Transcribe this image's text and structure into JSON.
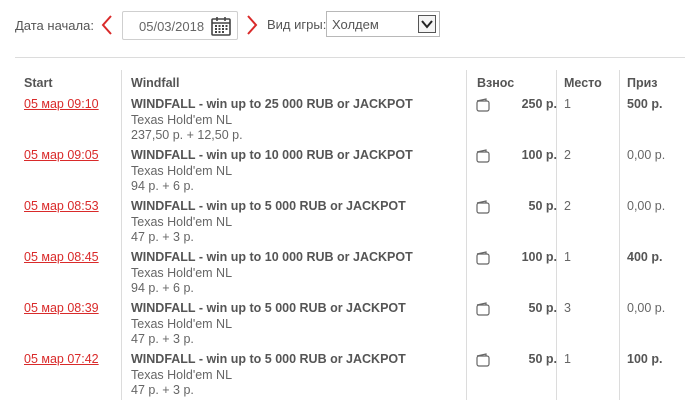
{
  "filters": {
    "date_label": "Дата начала:",
    "date_value": "05/03/2018",
    "game_label": "Вид игры:",
    "game_value": "Холдем"
  },
  "table": {
    "headers": {
      "start": "Start",
      "name": "Windfall",
      "fee": "Взнос",
      "place": "Место",
      "prize": "Приз"
    },
    "rows": [
      {
        "start": "05 мар 09:10",
        "title": "WINDFALL - win up to 25 000 RUB or JACKPOT",
        "game": "Texas Hold'em NL",
        "buyin": "237,50 р. + 12,50 р.",
        "fee": "250 р.",
        "place": "1",
        "prize": "500 р.",
        "prize_bold": true
      },
      {
        "start": "05 мар 09:05",
        "title": "WINDFALL - win up to 10 000 RUB or JACKPOT",
        "game": "Texas Hold'em NL",
        "buyin": "94 р. + 6 р.",
        "fee": "100 р.",
        "place": "2",
        "prize": "0,00 р.",
        "prize_bold": false
      },
      {
        "start": "05 мар 08:53",
        "title": "WINDFALL - win up to 5 000 RUB or JACKPOT",
        "game": "Texas Hold'em NL",
        "buyin": "47 р. + 3 р.",
        "fee": "50 р.",
        "place": "2",
        "prize": "0,00 р.",
        "prize_bold": false
      },
      {
        "start": "05 мар 08:45",
        "title": "WINDFALL - win up to 10 000 RUB or JACKPOT",
        "game": "Texas Hold'em NL",
        "buyin": "94 р. + 6 р.",
        "fee": "100 р.",
        "place": "1",
        "prize": "400 р.",
        "prize_bold": true
      },
      {
        "start": "05 мар 08:39",
        "title": "WINDFALL - win up to 5 000 RUB or JACKPOT",
        "game": "Texas Hold'em NL",
        "buyin": "47 р. + 3 р.",
        "fee": "50 р.",
        "place": "3",
        "prize": "0,00 р.",
        "prize_bold": false
      },
      {
        "start": "05 мар 07:42",
        "title": "WINDFALL - win up to 5 000 RUB or JACKPOT",
        "game": "Texas Hold'em NL",
        "buyin": "47 р. + 3 р.",
        "fee": "50 р.",
        "place": "1",
        "prize": "100 р.",
        "prize_bold": true
      }
    ]
  },
  "colors": {
    "accent": "#d92a2a",
    "text": "#555555",
    "border": "#dcdcdc"
  },
  "icons": {
    "prev": "chevron-left-icon",
    "next": "chevron-right-icon",
    "calendar": "calendar-icon",
    "select": "chevron-down-icon",
    "fee": "wallet-icon"
  }
}
